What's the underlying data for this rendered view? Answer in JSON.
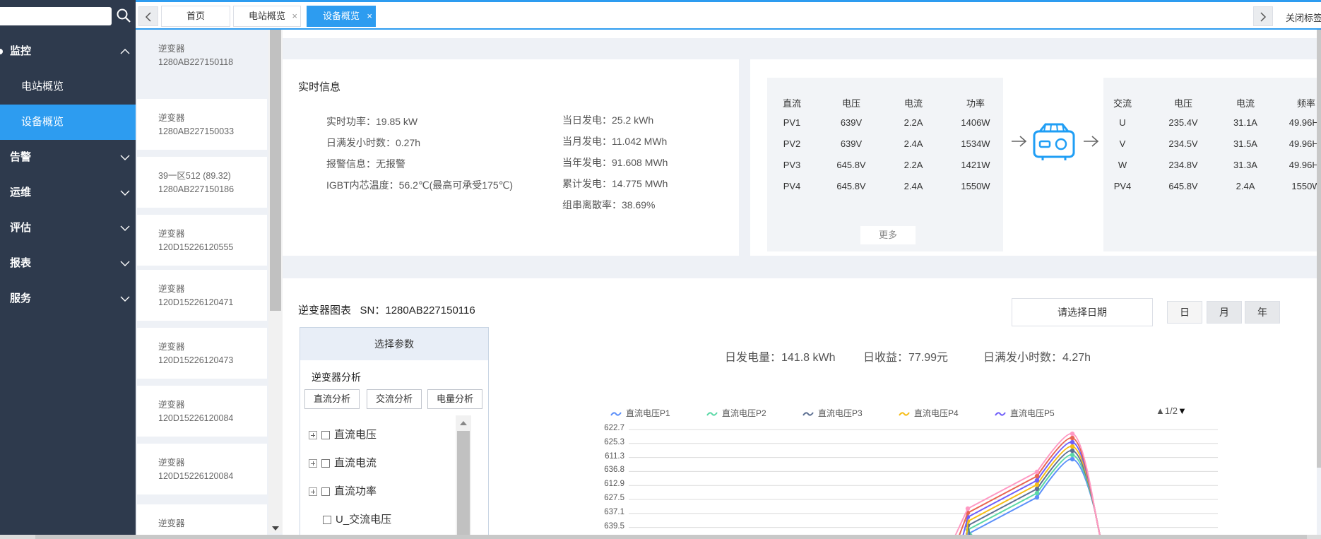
{
  "sidebar": {
    "search": {
      "placeholder": "",
      "value": ""
    },
    "menu": [
      {
        "label": "监控",
        "expanded": true,
        "children": [
          "电站概览",
          "设备概览"
        ]
      },
      {
        "label": "告警"
      },
      {
        "label": "运维"
      },
      {
        "label": "评估"
      },
      {
        "label": "报表"
      },
      {
        "label": "服务"
      }
    ],
    "active_sub": "设备概览"
  },
  "tabs": {
    "items": [
      {
        "label": "首页",
        "closable": false
      },
      {
        "label": "电站概览",
        "closable": true
      },
      {
        "label": "设备概览",
        "closable": true,
        "active": true
      }
    ],
    "close_label": "关闭标签"
  },
  "devices": [
    {
      "line1": "逆变器",
      "line2": "1280AB227150118"
    },
    {
      "line1": "逆变器",
      "line2": "1280AB227150033"
    },
    {
      "line1": "39一区512 (89.32)",
      "line2": "1280AB227150186"
    },
    {
      "line1": "逆变器",
      "line2": "120D15226120555"
    },
    {
      "line1": "逆变器",
      "line2": "120D15226120471"
    },
    {
      "line1": "逆变器",
      "line2": "120D15226120473"
    },
    {
      "line1": "逆变器",
      "line2": "120D15226120084"
    },
    {
      "line1": "逆变器",
      "line2": "120D15226120084"
    },
    {
      "line1": "逆变器",
      "line2": ""
    }
  ],
  "realtime": {
    "title": "实时信息",
    "left": [
      "实时功率：19.85 kW",
      "日满发小时数：0.27h",
      "报警信息：无报警",
      "IGBT内芯温度：56.2℃(最高可承受175℃)"
    ],
    "right": [
      "当日发电：25.2 kWh",
      "当月发电：11.042 MWh",
      "当年发电：91.608 MWh",
      "累计发电：14.775 MWh",
      "组串离散率：38.69%"
    ]
  },
  "dc_table": {
    "headers": [
      "直流",
      "电压",
      "电流",
      "功率"
    ],
    "rows": [
      [
        "PV1",
        "639V",
        "2.2A",
        "1406W"
      ],
      [
        "PV2",
        "639V",
        "2.4A",
        "1534W"
      ],
      [
        "PV3",
        "645.8V",
        "2.2A",
        "1421W"
      ],
      [
        "PV4",
        "645.8V",
        "2.4A",
        "1550W"
      ]
    ],
    "more_label": "更多"
  },
  "ac_table": {
    "headers": [
      "交流",
      "电压",
      "电流",
      "频率"
    ],
    "rows": [
      [
        "U",
        "235.4V",
        "31.1A",
        "49.96Hz"
      ],
      [
        "V",
        "234.5V",
        "31.5A",
        "49.96Hz"
      ],
      [
        "W",
        "234.8V",
        "31.3A",
        "49.96Hz"
      ],
      [
        "PV4",
        "645.8V",
        "2.4A",
        "1550W"
      ]
    ]
  },
  "chart_section": {
    "title": "逆变器图表",
    "sn_label": "SN：1280AB227150116",
    "date_button": "请选择日期",
    "periods": [
      "日",
      "月",
      "年"
    ],
    "stats": [
      "日发电量：141.8 kWh",
      "日收益：77.99元",
      "日满发小时数：4.27h"
    ],
    "params": {
      "header": "选择参数",
      "group_label": "逆变器分析",
      "buttons": [
        "直流分析",
        "交流分析",
        "电量分析"
      ],
      "tree": [
        {
          "label": "直流电压",
          "expandable": true
        },
        {
          "label": "直流电流",
          "expandable": true
        },
        {
          "label": "直流功率",
          "expandable": true
        },
        {
          "label": "U_交流电压",
          "expandable": false
        }
      ]
    },
    "legend_pager": "1/2"
  },
  "chart_data": {
    "type": "line",
    "series": [
      {
        "name": "直流电压P1",
        "color": "#5b8ff9",
        "values": [
          0,
          0,
          0,
          0,
          0,
          0,
          0,
          0,
          0,
          0,
          0,
          0,
          635.0,
          629.0,
          624.5,
          639.5
        ]
      },
      {
        "name": "直流电压P2",
        "color": "#5ad8a6",
        "values": [
          0,
          0,
          0,
          0,
          0,
          0,
          0,
          0,
          0,
          0,
          0,
          0,
          638.0,
          632.0,
          626.5,
          639.5
        ]
      },
      {
        "name": "直流电压P3",
        "color": "#5d7092",
        "values": [
          0,
          0,
          0,
          0,
          0,
          0,
          0,
          0,
          0,
          0,
          0,
          0,
          636.5,
          630.5,
          625.5,
          639.5
        ]
      },
      {
        "name": "直流电压P4",
        "color": "#f6bd16",
        "values": [
          0,
          0,
          0,
          0,
          0,
          0,
          0,
          0,
          0,
          0,
          0,
          0,
          637.0,
          631.0,
          626.0,
          639.5
        ]
      },
      {
        "name": "直流电压P5",
        "color": "#6f5ef9",
        "values": [
          0,
          0,
          0,
          0,
          0,
          0,
          0,
          0,
          0,
          0,
          0,
          0,
          634.5,
          628.5,
          623.5,
          639.5
        ]
      }
    ],
    "extra_series_colors": [
      "#e86452",
      "#ff99c3"
    ],
    "y_ticks": [
      "622.7",
      "625.3",
      "611.3",
      "636.8",
      "612.9",
      "627.5",
      "637.1",
      "639.5"
    ],
    "grid": true,
    "legend_position": "top"
  }
}
